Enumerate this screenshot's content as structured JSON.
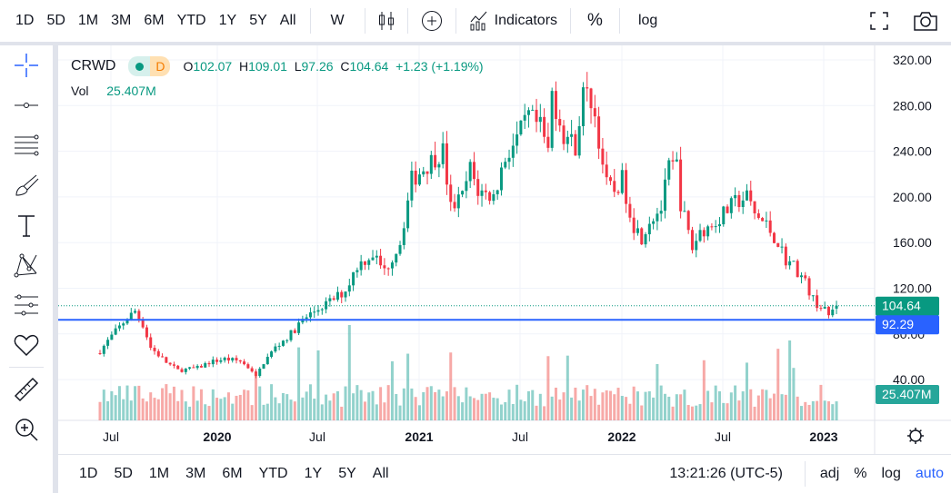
{
  "toolbar": {
    "ranges": [
      "1D",
      "5D",
      "1M",
      "3M",
      "6M",
      "YTD",
      "1Y",
      "5Y",
      "All"
    ],
    "interval": "W",
    "indicators_label": "Indicators",
    "percent_label": "%",
    "log_label": "log"
  },
  "legend": {
    "symbol": "CRWD",
    "interval_badge": "D",
    "o_label": "O",
    "open": "102.07",
    "h_label": "H",
    "high": "109.01",
    "l_label": "L",
    "low": "97.26",
    "c_label": "C",
    "close": "104.64",
    "change": "+1.23 (+1.19%)",
    "vol_label": "Vol",
    "volume": "25.407M"
  },
  "price_axis": {
    "ticks": [
      "320.00",
      "280.00",
      "240.00",
      "200.00",
      "160.00",
      "120.00",
      "80.00",
      "40.00"
    ],
    "last_price": "104.64",
    "line_price": "92.29",
    "volume_label": "25.407M"
  },
  "time_axis": {
    "labels": [
      "Jul",
      "2020",
      "Jul",
      "2021",
      "Jul",
      "2022",
      "Jul",
      "2023"
    ]
  },
  "bottom": {
    "ranges": [
      "1D",
      "5D",
      "1M",
      "3M",
      "6M",
      "YTD",
      "1Y",
      "5Y",
      "All"
    ],
    "time": "13:21:26 (UTC-5)",
    "adj": "adj",
    "percent": "%",
    "log": "log",
    "auto": "auto"
  },
  "colors": {
    "up": "#089981",
    "down": "#f23645",
    "hline": "#2962ff"
  },
  "price_path": [
    [
      0,
      65
    ],
    [
      3,
      78
    ],
    [
      6,
      90
    ],
    [
      9,
      100
    ],
    [
      11,
      88
    ],
    [
      13,
      68
    ],
    [
      17,
      55
    ],
    [
      20,
      48
    ],
    [
      25,
      50
    ],
    [
      28,
      55
    ],
    [
      32,
      58
    ],
    [
      36,
      56
    ],
    [
      39,
      48
    ],
    [
      40,
      42
    ],
    [
      42,
      55
    ],
    [
      45,
      68
    ],
    [
      49,
      80
    ],
    [
      52,
      92
    ],
    [
      56,
      102
    ],
    [
      59,
      108
    ],
    [
      63,
      118
    ],
    [
      66,
      140
    ],
    [
      70,
      150
    ],
    [
      73,
      135
    ],
    [
      77,
      160
    ],
    [
      80,
      215
    ],
    [
      83,
      225
    ],
    [
      86,
      235
    ],
    [
      88,
      240
    ],
    [
      90,
      190
    ],
    [
      93,
      200
    ],
    [
      95,
      225
    ],
    [
      97,
      205
    ],
    [
      101,
      200
    ],
    [
      104,
      235
    ],
    [
      107,
      250
    ],
    [
      110,
      270
    ],
    [
      113,
      260
    ],
    [
      115,
      240
    ],
    [
      116,
      290
    ],
    [
      119,
      255
    ],
    [
      122,
      245
    ],
    [
      124,
      290
    ],
    [
      126,
      285
    ],
    [
      127,
      270
    ],
    [
      130,
      210
    ],
    [
      132,
      205
    ],
    [
      134,
      215
    ],
    [
      137,
      175
    ],
    [
      139,
      165
    ],
    [
      141,
      180
    ],
    [
      144,
      190
    ],
    [
      146,
      225
    ],
    [
      148,
      228
    ],
    [
      149,
      195
    ],
    [
      152,
      155
    ],
    [
      154,
      170
    ],
    [
      157,
      175
    ],
    [
      160,
      185
    ],
    [
      163,
      195
    ],
    [
      166,
      200
    ],
    [
      168,
      185
    ],
    [
      171,
      175
    ],
    [
      174,
      160
    ],
    [
      176,
      145
    ],
    [
      178,
      140
    ],
    [
      181,
      125
    ],
    [
      183,
      110
    ],
    [
      186,
      100
    ],
    [
      187,
      96
    ],
    [
      189,
      104.64
    ]
  ]
}
